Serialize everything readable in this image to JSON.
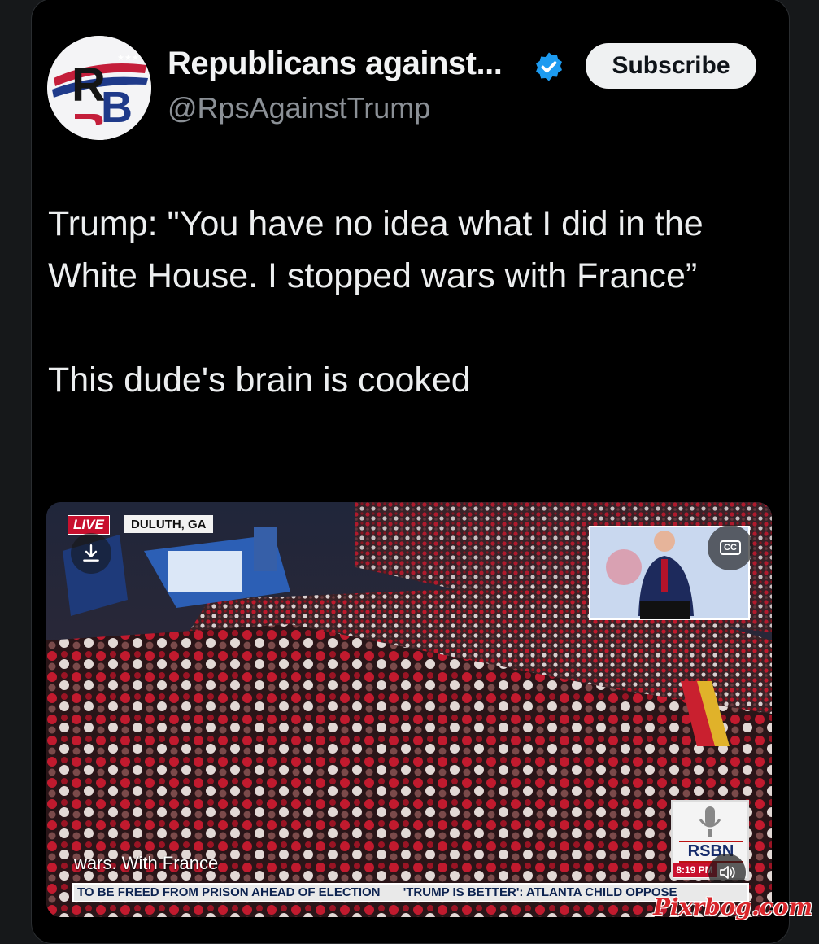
{
  "account": {
    "name": "Republicans against...",
    "handle": "@RpsAgainstTrump",
    "avatar_letters": "RB",
    "verified": true
  },
  "subscribe_label": "Subscribe",
  "tweet": {
    "line1": "Trump: \"You have no idea what I did in the White House. I stopped wars with France”",
    "line2": "This dude's brain is cooked"
  },
  "video": {
    "live_label": "LIVE",
    "location": "DULUTH, GA",
    "cc_label": "CC",
    "caption": "wars. With France",
    "ticker": [
      "TO BE FREED FROM PRISON AHEAD OF ELECTION",
      "'TRUMP IS BETTER': ATLANTA CHILD OPPOSE"
    ],
    "network": "RSBN",
    "time": "8:19 PM",
    "icons": [
      "download-icon",
      "cc-icon",
      "volume-icon"
    ]
  },
  "watermark": "Pixrbog.com"
}
